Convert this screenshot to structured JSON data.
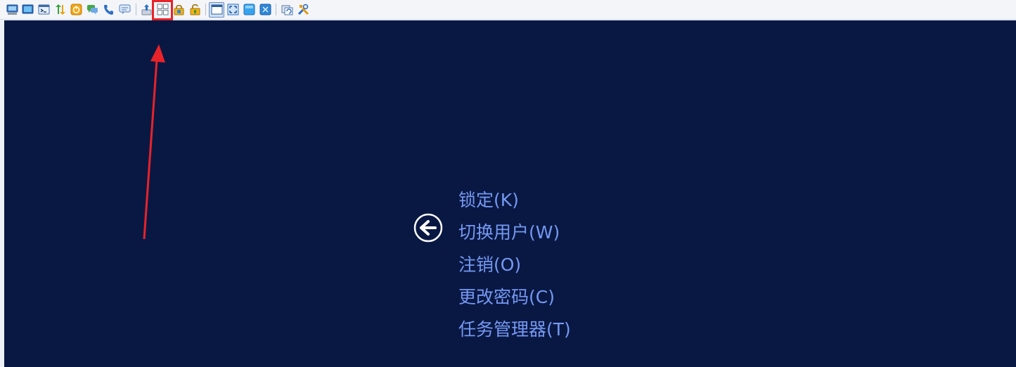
{
  "toolbar": {
    "buttons": [
      {
        "name": "ctrl-alt-del-icon"
      },
      {
        "name": "screen-icon"
      },
      {
        "name": "terminal-icon"
      },
      {
        "name": "transfer-arrows-icon"
      },
      {
        "name": "power-icon"
      },
      {
        "name": "chat-icon"
      },
      {
        "name": "phone-icon"
      },
      {
        "name": "message-icon"
      },
      {
        "name": "upload-icon"
      },
      {
        "name": "task-manager-icon",
        "highlighted": true
      },
      {
        "name": "lock-icon"
      },
      {
        "name": "unlock-icon"
      },
      {
        "name": "window-mode-icon",
        "toggled": true
      },
      {
        "name": "fit-screen-icon"
      },
      {
        "name": "fullscreen-icon"
      },
      {
        "name": "scale-icon"
      },
      {
        "name": "refresh-icon"
      },
      {
        "name": "settings-tools-icon"
      }
    ]
  },
  "remote_screen": {
    "background": "#091843",
    "back_icon": "back-arrow-icon",
    "menu_color": "#7598f2",
    "menu": [
      {
        "label": "锁定(K)"
      },
      {
        "label": "切换用户(W)"
      },
      {
        "label": "注销(O)"
      },
      {
        "label": "更改密码(C)"
      },
      {
        "label": "任务管理器(T)"
      }
    ]
  },
  "annotation": {
    "color": "#e8232a"
  }
}
